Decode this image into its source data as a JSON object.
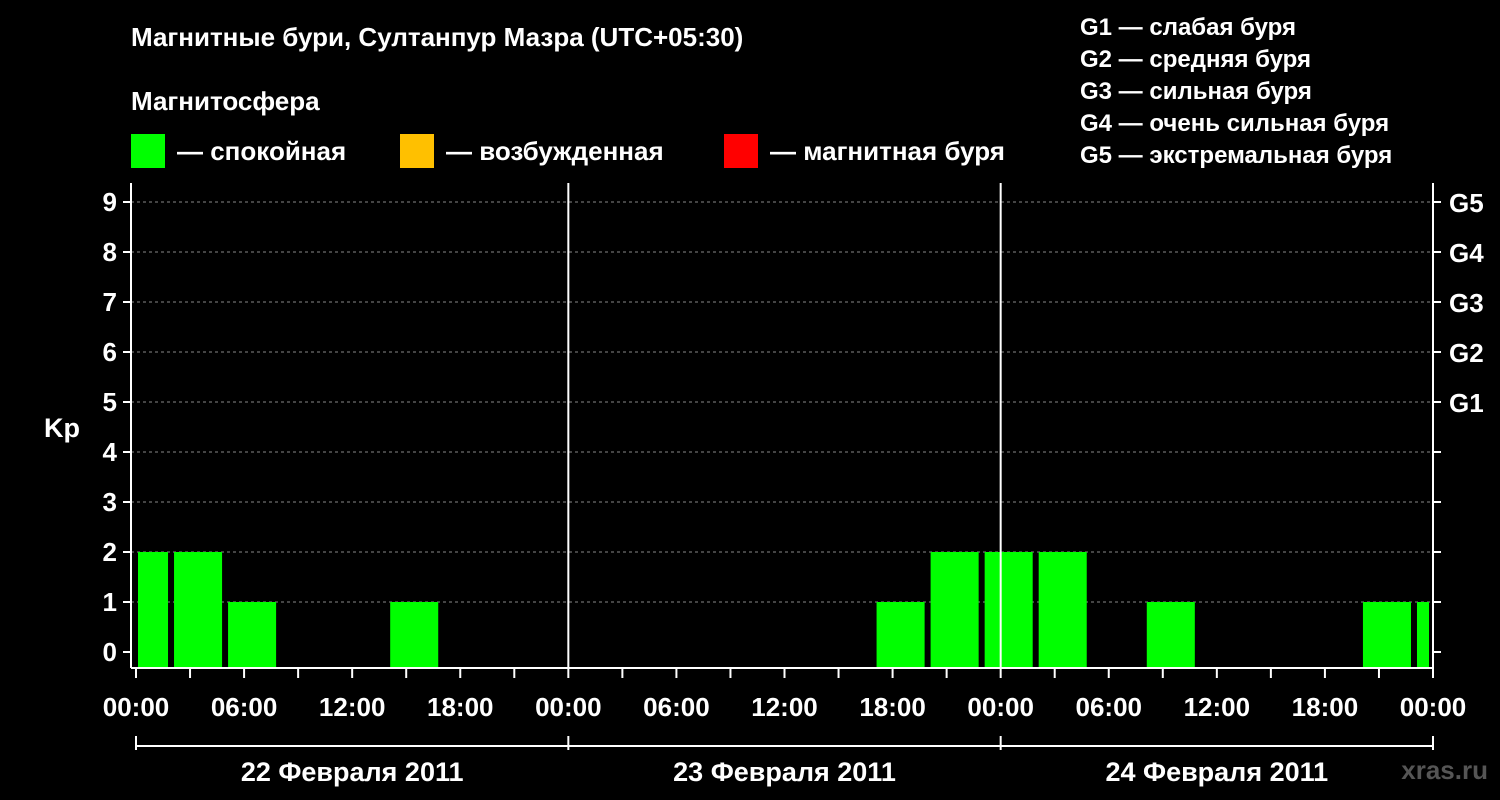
{
  "title": "Магнитные бури, Султанпур Мазра (UTC+05:30)",
  "magnetosphere": {
    "heading": "Магнитосфера",
    "items": [
      {
        "label": "— спокойная",
        "color": "#00ff00"
      },
      {
        "label": "— возбужденная",
        "color": "#ffc000"
      },
      {
        "label": "— магнитная буря",
        "color": "#ff0000"
      }
    ]
  },
  "storm_scale": [
    "G1 — слабая буря",
    "G2 — средняя буря",
    "G3 — сильная буря",
    "G4 — очень сильная буря",
    "G5 — экстремальная буря"
  ],
  "site": "xras.ru",
  "chart_data": {
    "type": "bar",
    "ylabel": "Kp",
    "ylim": [
      0,
      9
    ],
    "yticks": [
      0,
      1,
      2,
      3,
      4,
      5,
      6,
      7,
      8,
      9
    ],
    "gscale": [
      {
        "kp": 5,
        "label": "G1"
      },
      {
        "kp": 6,
        "label": "G2"
      },
      {
        "kp": 7,
        "label": "G3"
      },
      {
        "kp": 8,
        "label": "G4"
      },
      {
        "kp": 9,
        "label": "G5"
      }
    ],
    "xticklabels": [
      "00:00",
      "06:00",
      "12:00",
      "18:00",
      "00:00",
      "06:00",
      "12:00",
      "18:00",
      "00:00",
      "06:00",
      "12:00",
      "18:00",
      "00:00"
    ],
    "days": [
      "22 Февраля 2011",
      "23 Февраля 2011",
      "24 Февраля 2011"
    ],
    "grid": true,
    "bar_color": "#00ff00",
    "bars": [
      {
        "start": "2011-02-22 00:00",
        "end": "2011-02-22 02:00",
        "kp": 2
      },
      {
        "start": "2011-02-22 02:00",
        "end": "2011-02-22 05:00",
        "kp": 2
      },
      {
        "start": "2011-02-22 05:00",
        "end": "2011-02-22 08:00",
        "kp": 1
      },
      {
        "start": "2011-02-22 08:00",
        "end": "2011-02-22 11:00",
        "kp": 0
      },
      {
        "start": "2011-02-22 11:00",
        "end": "2011-02-22 14:00",
        "kp": 0
      },
      {
        "start": "2011-02-22 14:00",
        "end": "2011-02-22 17:00",
        "kp": 1
      },
      {
        "start": "2011-02-22 17:00",
        "end": "2011-02-22 20:00",
        "kp": 0
      },
      {
        "start": "2011-02-22 20:00",
        "end": "2011-02-22 23:00",
        "kp": 0
      },
      {
        "start": "2011-02-22 23:00",
        "end": "2011-02-23 02:00",
        "kp": 0
      },
      {
        "start": "2011-02-23 02:00",
        "end": "2011-02-23 05:00",
        "kp": 0
      },
      {
        "start": "2011-02-23 05:00",
        "end": "2011-02-23 08:00",
        "kp": 0
      },
      {
        "start": "2011-02-23 08:00",
        "end": "2011-02-23 11:00",
        "kp": 0
      },
      {
        "start": "2011-02-23 11:00",
        "end": "2011-02-23 14:00",
        "kp": 0
      },
      {
        "start": "2011-02-23 14:00",
        "end": "2011-02-23 17:00",
        "kp": 0
      },
      {
        "start": "2011-02-23 17:00",
        "end": "2011-02-23 20:00",
        "kp": 1
      },
      {
        "start": "2011-02-23 20:00",
        "end": "2011-02-23 23:00",
        "kp": 2
      },
      {
        "start": "2011-02-23 23:00",
        "end": "2011-02-24 02:00",
        "kp": 2
      },
      {
        "start": "2011-02-24 02:00",
        "end": "2011-02-24 05:00",
        "kp": 2
      },
      {
        "start": "2011-02-24 05:00",
        "end": "2011-02-24 08:00",
        "kp": 0
      },
      {
        "start": "2011-02-24 08:00",
        "end": "2011-02-24 11:00",
        "kp": 1
      },
      {
        "start": "2011-02-24 11:00",
        "end": "2011-02-24 14:00",
        "kp": 0
      },
      {
        "start": "2011-02-24 14:00",
        "end": "2011-02-24 17:00",
        "kp": 0
      },
      {
        "start": "2011-02-24 17:00",
        "end": "2011-02-24 20:00",
        "kp": 0
      },
      {
        "start": "2011-02-24 20:00",
        "end": "2011-02-24 23:00",
        "kp": 1
      },
      {
        "start": "2011-02-24 23:00",
        "end": "2011-02-25 00:00",
        "kp": 1
      }
    ]
  }
}
